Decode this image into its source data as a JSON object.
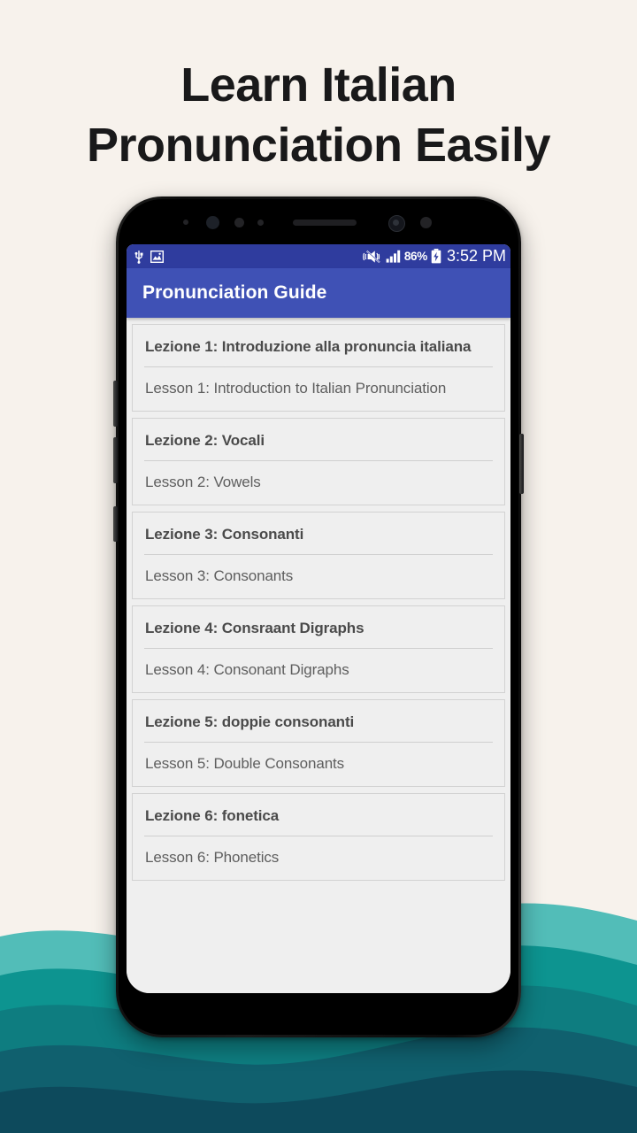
{
  "page": {
    "background_color": "#F7F2EC",
    "headline_lines": [
      "Learn Italian",
      "Pronunciation Easily"
    ]
  },
  "waves": {
    "colors": [
      "#52BDB8",
      "#0D9490",
      "#0E7D80",
      "#10606E",
      "#0D4A5C"
    ]
  },
  "phone": {
    "statusbar": {
      "background_color": "#2F3C9E",
      "icons_left": [
        "usb-icon",
        "screenshot-image-icon"
      ],
      "icons_right": [
        "vibrate-mute-icon",
        "signal-bars-icon",
        "battery-charging-icon"
      ],
      "battery_percent": "86%",
      "clock": "3:52 PM"
    },
    "appbar": {
      "title": "Pronunciation Guide",
      "background_color": "#3F51B5",
      "text_color": "#FFFFFF"
    },
    "lessons": [
      {
        "italian": "Lezione 1: Introduzione alla pronuncia italiana",
        "english": "Lesson 1: Introduction to Italian Pronunciation"
      },
      {
        "italian": "Lezione 2: Vocali",
        "english": "Lesson 2: Vowels"
      },
      {
        "italian": "Lezione 3: Consonanti",
        "english": "Lesson 3: Consonants"
      },
      {
        "italian": "Lezione 4: Consraant Digraphs",
        "english": "Lesson 4: Consonant Digraphs"
      },
      {
        "italian": "Lezione 5: doppie consonanti",
        "english": "Lesson 5: Double Consonants"
      },
      {
        "italian": "Lezione 6: fonetica",
        "english": "Lesson 6: Phonetics"
      }
    ]
  }
}
